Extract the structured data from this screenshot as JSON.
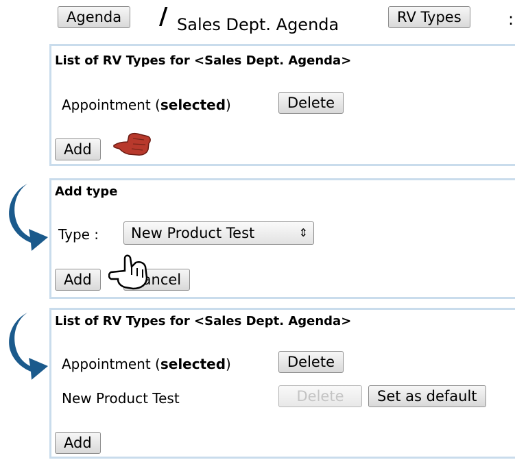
{
  "breadcrumb": {
    "agenda_button": "Agenda",
    "separator": "/",
    "agenda_name": "Sales Dept. Agenda",
    "rv_types_button": "RV Types",
    "trailing": ":"
  },
  "panel_list_1": {
    "title": "List of RV Types for <Sales Dept. Agenda>",
    "rows": [
      {
        "name": "Appointment",
        "status": "selected",
        "delete_label": "Delete"
      }
    ],
    "add_label": "Add"
  },
  "panel_add": {
    "title": "Add type",
    "type_label": "Type :",
    "type_value": "New Product Test",
    "add_label": "Add",
    "cancel_label": "Cancel"
  },
  "panel_list_2": {
    "title": "List of RV Types for <Sales Dept. Agenda>",
    "rows": [
      {
        "name": "Appointment",
        "status": "selected",
        "delete_label": "Delete"
      },
      {
        "name": "New Product Test",
        "delete_label": "Delete",
        "default_label": "Set as default"
      }
    ],
    "add_label": "Add"
  },
  "colors": {
    "panel_border": "#c9dcec",
    "arrow": "#1b5a8c",
    "pointer_hand": "#b8392c"
  },
  "icons": [
    "pointing-hand-icon",
    "hand-cursor-icon",
    "curved-arrow-icon"
  ]
}
